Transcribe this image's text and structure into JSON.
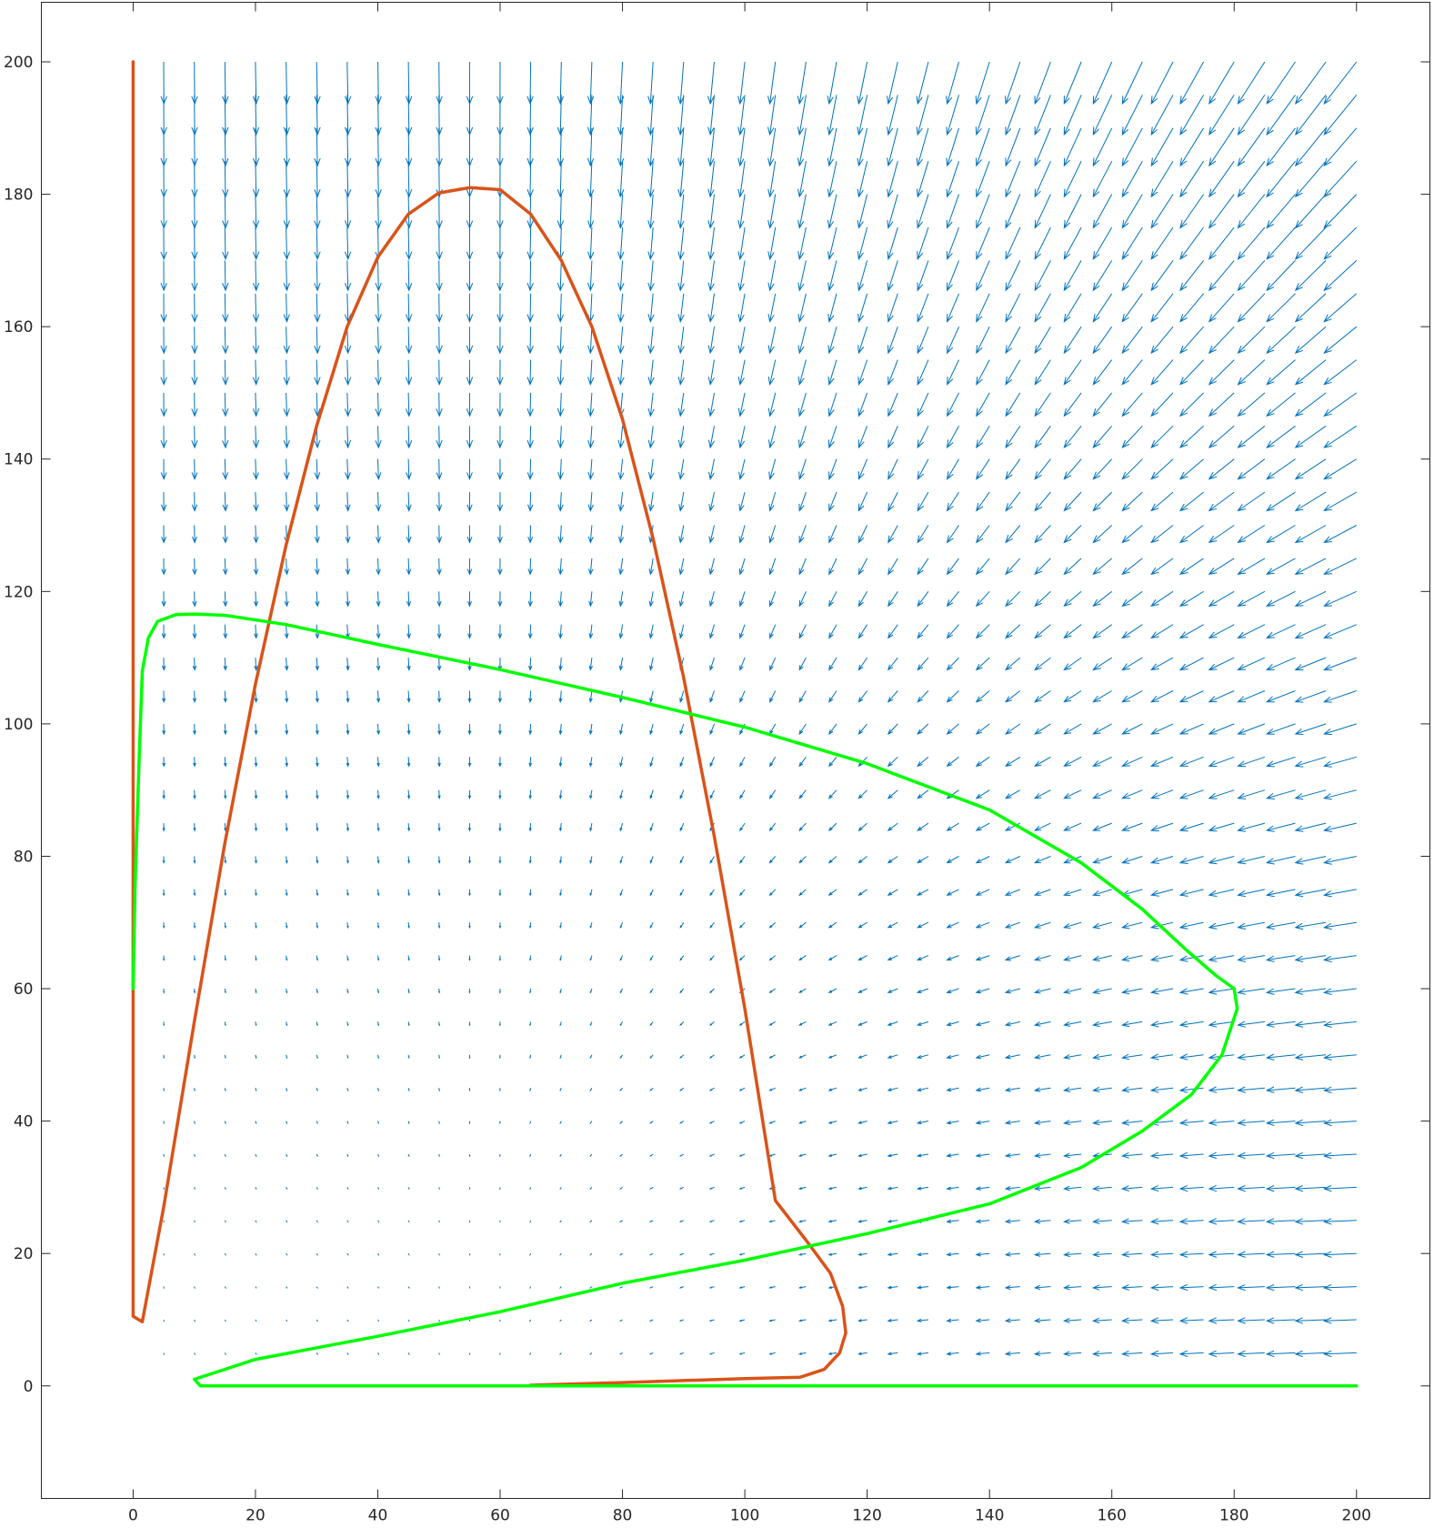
{
  "chart_data": {
    "type": "line",
    "title": "",
    "xlabel": "",
    "ylabel": "",
    "xlim": [
      -15,
      212
    ],
    "ylim": [
      -17,
      209
    ],
    "grid": false,
    "xticks": [
      0,
      20,
      40,
      60,
      80,
      100,
      120,
      140,
      160,
      180,
      200
    ],
    "yticks": [
      0,
      20,
      40,
      60,
      80,
      100,
      120,
      140,
      160,
      180,
      200
    ],
    "xtick_labels": [
      "0",
      "20",
      "40",
      "60",
      "80",
      "100",
      "120",
      "140",
      "160",
      "180",
      "200"
    ],
    "ytick_labels": [
      "0",
      "20",
      "40",
      "60",
      "80",
      "100",
      "120",
      "140",
      "160",
      "180",
      "200"
    ],
    "quiver": {
      "color": "#0072BD",
      "description_of_field": "vector field sampled on a 5-unit grid from x=5..200, y=5..200",
      "x_range": [
        5,
        200
      ],
      "y_range": [
        5,
        200
      ],
      "step": 5
    },
    "series": [
      {
        "color": "#D95319",
        "x": [
          0,
          0,
          0,
          0,
          0,
          1.5,
          5,
          10,
          15,
          20,
          25,
          30,
          35,
          40,
          45,
          50,
          55,
          60,
          65,
          70,
          75,
          80,
          85,
          90,
          95,
          100,
          105,
          110,
          114,
          116,
          116.5,
          115.5,
          113,
          109,
          100,
          90,
          80,
          65
        ],
        "y": [
          200,
          150,
          100,
          50,
          10.5,
          9.7,
          27,
          55,
          82,
          106,
          127,
          145,
          160,
          170.5,
          177,
          180.2,
          181,
          180.7,
          177,
          170,
          160,
          146,
          128,
          107,
          83,
          57,
          28,
          22,
          17,
          12,
          8,
          5,
          2.5,
          1.3,
          1.1,
          0.8,
          0.5,
          0.1
        ]
      },
      {
        "color": "#00FF00",
        "x": [
          0,
          0.3,
          1,
          1.5,
          2.5,
          4,
          7,
          10,
          15,
          25,
          40,
          60,
          80,
          100,
          120,
          140,
          155,
          165,
          172,
          177,
          180,
          180.5,
          178,
          173,
          165,
          155,
          140,
          120,
          100,
          80,
          60,
          40,
          20,
          10,
          11,
          50,
          100,
          150,
          200
        ],
        "y": [
          60,
          75,
          95,
          108,
          113,
          115.5,
          116.5,
          116.6,
          116.4,
          115,
          112,
          108.2,
          104,
          99.5,
          94,
          87,
          79,
          72,
          66,
          62,
          60,
          57,
          50,
          44,
          38.5,
          33,
          27.5,
          23,
          19,
          15.5,
          11.2,
          7.5,
          4,
          1,
          0,
          0,
          0,
          0,
          0
        ]
      }
    ]
  }
}
